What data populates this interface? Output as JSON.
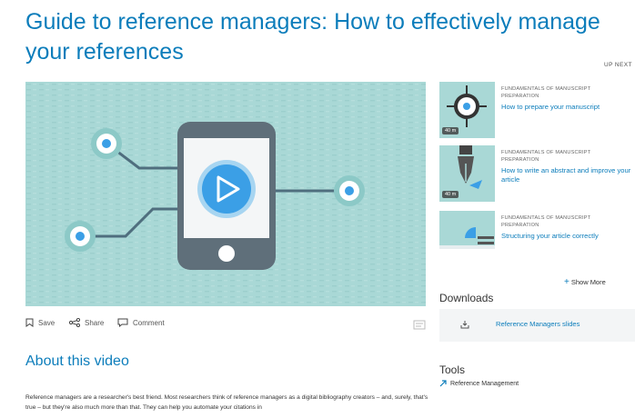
{
  "page": {
    "title": "Guide to reference managers: How to effectively manage your references",
    "up_next_label": "UP NEXT"
  },
  "video_actions": {
    "save_label": "Save",
    "share_label": "Share",
    "comment_label": "Comment"
  },
  "about": {
    "heading": "About this video",
    "text": "Reference managers are a researcher's best friend. Most researchers think of reference managers as a digital bibliography creators – and, surely, that's true – but they're also much more than that. They can help you automate your citations in"
  },
  "up_next": [
    {
      "category": "FUNDAMENTALS OF MANUSCRIPT PREPARATION",
      "title": "How to prepare your manuscript",
      "duration": "40 m",
      "icon": "target-icon"
    },
    {
      "category": "FUNDAMENTALS OF MANUSCRIPT PREPARATION",
      "title": "How to write an abstract and improve your article",
      "duration": "40 m",
      "icon": "pen-nib-icon"
    },
    {
      "category": "FUNDAMENTALS OF MANUSCRIPT PREPARATION",
      "title": "Structuring your article correctly",
      "duration": "",
      "icon": "structure-icon"
    }
  ],
  "show_more_label": "Show More",
  "downloads": {
    "heading": "Downloads",
    "items": [
      {
        "label": "Reference Managers slides",
        "icon": "download-icon"
      }
    ]
  },
  "tools": {
    "heading": "Tools",
    "items": [
      {
        "label": "Reference Management",
        "icon": "external-arrow-icon"
      }
    ]
  },
  "colors": {
    "accent": "#0c7dbb",
    "video_bg": "#a9d8d6",
    "play": "#3b9fe6"
  }
}
